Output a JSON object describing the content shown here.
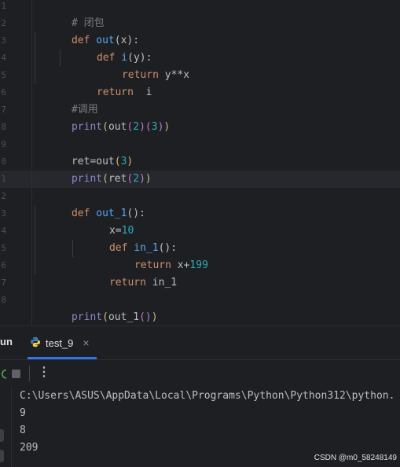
{
  "editor": {
    "gutter_numbers": [
      "1",
      "2",
      "3",
      "4",
      "5",
      "6",
      "7",
      "8",
      "9",
      "0",
      "1",
      "2",
      "3",
      "4",
      "5",
      "6",
      "7",
      "8"
    ],
    "lines": {
      "l1": {
        "hash": "# ",
        "text": "闭包"
      },
      "l2": {
        "kw": "def",
        "name": "out",
        "open": "(",
        "arg": "x",
        "close": "):"
      },
      "l3": {
        "kw": "def",
        "name": "i",
        "open": "(",
        "arg": "y",
        "close": "):"
      },
      "l4": {
        "kw": "return",
        "expr": "y**x"
      },
      "l5": {
        "kw": "return",
        "expr": "i"
      },
      "l6": {
        "comment": "#调用"
      },
      "l7": {
        "builtin": "print",
        "p_open": "(",
        "call": "out",
        "a_open": "(",
        "a_val": "2",
        "a_close": ")",
        "b_open": "(",
        "b_val": "3",
        "b_close": ")",
        "p_close": ")"
      },
      "l9": {
        "lhs": "ret=",
        "call": "out",
        "a_open": "(",
        "a_val": "3",
        "a_close": ")"
      },
      "l10": {
        "builtin": "print",
        "p_open": "(",
        "call": "ret",
        "a_open": "(",
        "a_val": "2",
        "a_close": ")",
        "p_close": ")"
      },
      "l12": {
        "kw": "def",
        "name": "out_1",
        "parens": "():"
      },
      "l13": {
        "lhs": "x=",
        "val": "10"
      },
      "l14": {
        "kw": "def",
        "name": "in_1",
        "parens": "():"
      },
      "l15": {
        "kw": "return",
        "expr": "x+",
        "val": "199"
      },
      "l16": {
        "kw": "return",
        "expr": "in_1"
      },
      "l18": {
        "builtin": "print",
        "p_open": "(",
        "call": "out_1",
        "inner": "()",
        "p_close": ")"
      }
    }
  },
  "run_panel": {
    "title": "un",
    "tab_label": "test_9",
    "close_glyph": "×",
    "more_glyph": "⋮",
    "output": [
      "C:\\Users\\ASUS\\AppData\\Local\\Programs\\Python\\Python312\\python.",
      "9",
      "8",
      "209"
    ]
  },
  "watermark": "CSDN @m0_58248149",
  "colors": {
    "background": "#1e1f22",
    "keyword": "#cf8e6d",
    "function": "#56a8f5",
    "builtin": "#8888c6",
    "number": "#2aacb8",
    "comment": "#7a7e85",
    "text": "#bcbec4",
    "accent": "#3574f0"
  },
  "icons": [
    "python-file-icon",
    "close-icon",
    "rerun-icon",
    "stop-icon",
    "more-icon"
  ]
}
